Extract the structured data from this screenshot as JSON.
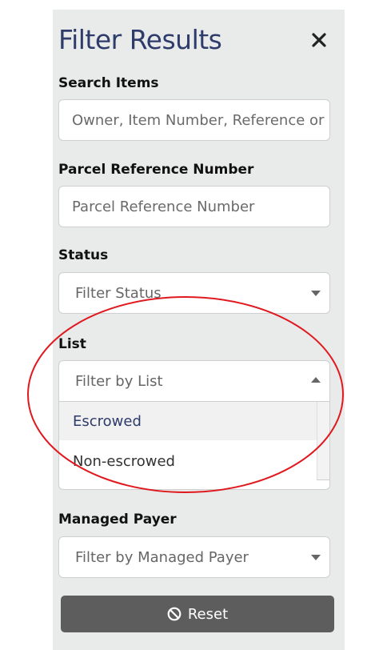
{
  "panel": {
    "title": "Filter Results",
    "close_icon": "close-icon"
  },
  "search_items": {
    "label": "Search Items",
    "placeholder": "Owner, Item Number, Reference or"
  },
  "parcel_reference": {
    "label": "Parcel Reference Number",
    "placeholder": "Parcel Reference Number"
  },
  "status": {
    "label": "Status",
    "placeholder": "Filter Status"
  },
  "list": {
    "label": "List",
    "placeholder": "Filter by List",
    "options": [
      "Escrowed",
      "Non-escrowed"
    ],
    "highlighted_option": "Escrowed"
  },
  "managed_payer": {
    "label": "Managed Payer",
    "placeholder": "Filter by Managed Payer"
  },
  "reset": {
    "label": "Reset",
    "icon": "ban-icon"
  },
  "colors": {
    "panel_bg": "#e9eaea",
    "title": "#2e3b6b",
    "reset_bg": "#5d5d5d",
    "annotation": "#e0191f"
  }
}
